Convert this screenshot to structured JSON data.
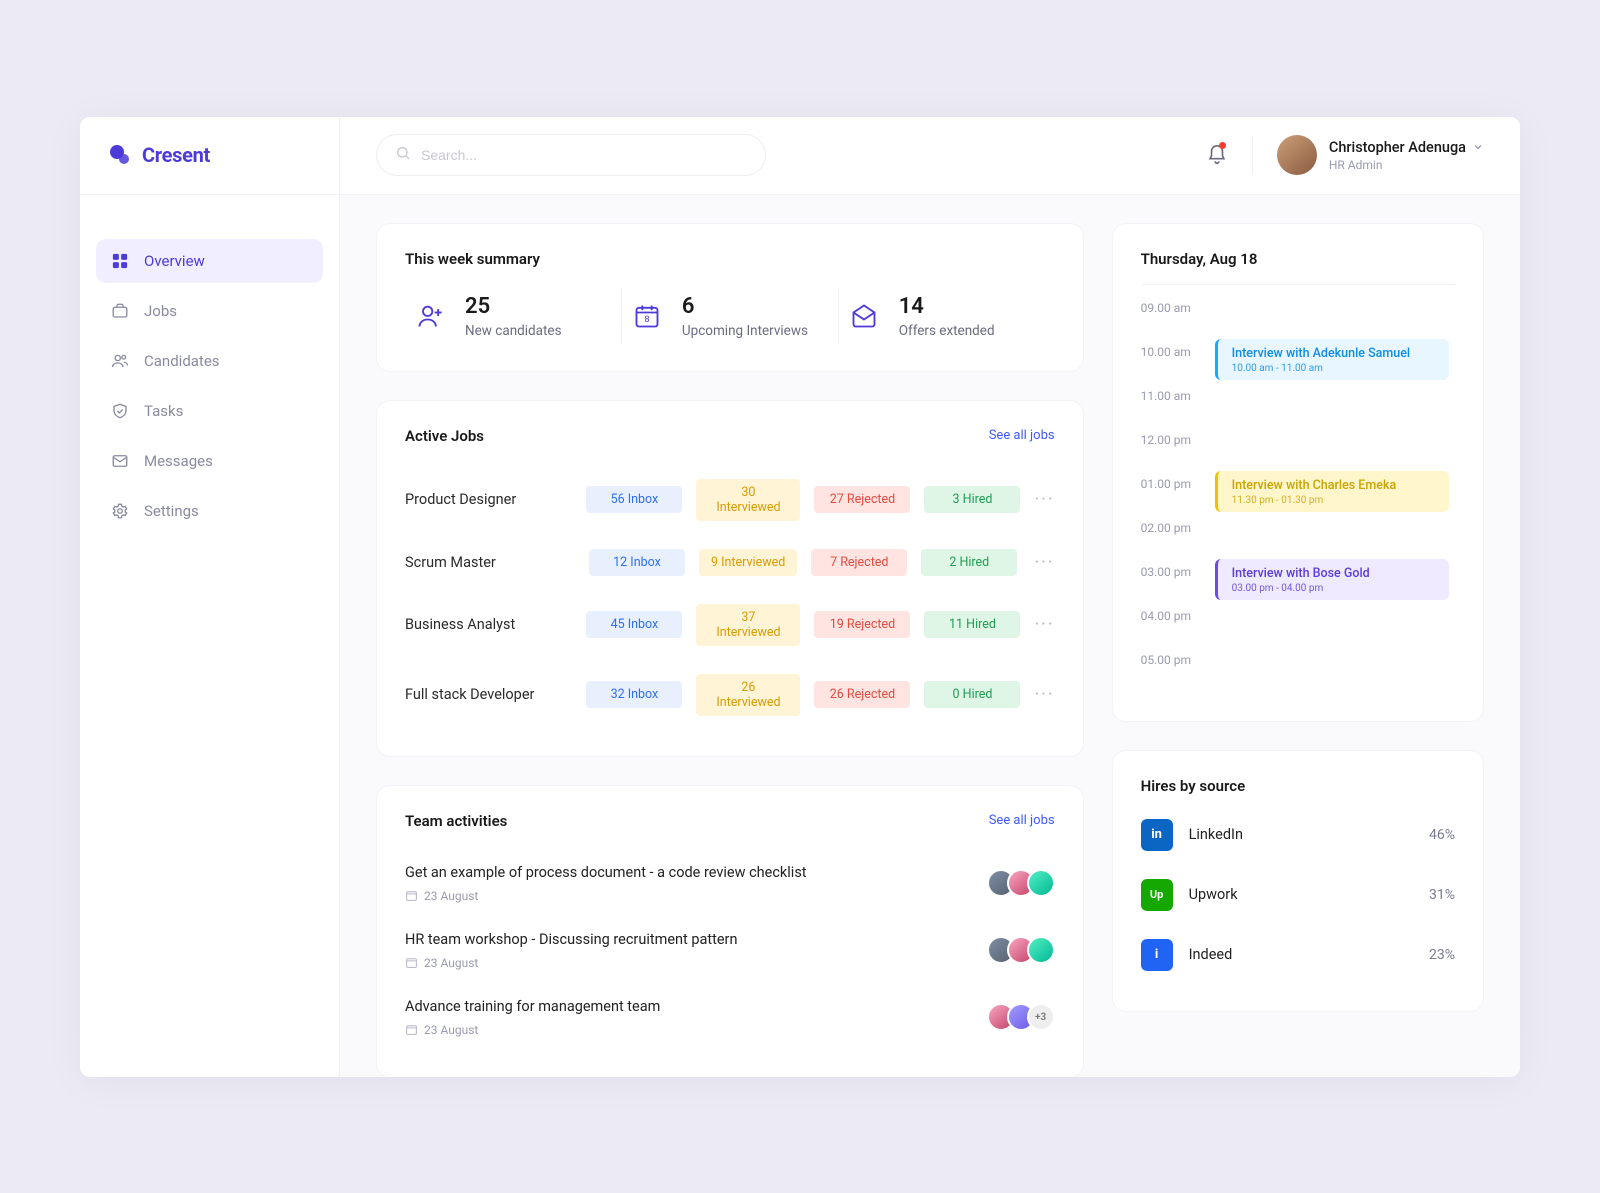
{
  "brand": {
    "name": "Cresent"
  },
  "nav": {
    "items": [
      {
        "label": "Overview",
        "icon": "grid-icon",
        "active": true
      },
      {
        "label": "Jobs",
        "icon": "briefcase-icon",
        "active": false
      },
      {
        "label": "Candidates",
        "icon": "users-icon",
        "active": false
      },
      {
        "label": "Tasks",
        "icon": "shield-check-icon",
        "active": false
      },
      {
        "label": "Messages",
        "icon": "mail-icon",
        "active": false
      },
      {
        "label": "Settings",
        "icon": "gear-icon",
        "active": false
      }
    ]
  },
  "search": {
    "placeholder": "Search..."
  },
  "user": {
    "name": "Christopher Adenuga",
    "role": "HR Admin"
  },
  "summary": {
    "title": "This week summary",
    "stats": [
      {
        "value": "25",
        "label": "New candidates",
        "icon": "user-plus-icon"
      },
      {
        "value": "6",
        "label": "Upcoming Interviews",
        "icon": "calendar-icon"
      },
      {
        "value": "14",
        "label": "Offers extended",
        "icon": "mail-open-icon"
      }
    ]
  },
  "jobs": {
    "title": "Active Jobs",
    "see_all": "See all jobs",
    "rows": [
      {
        "name": "Product Designer",
        "inbox": "56 Inbox",
        "interviewed": "30 Interviewed",
        "rejected": "27 Rejected",
        "hired": "3 Hired"
      },
      {
        "name": "Scrum Master",
        "inbox": "12 Inbox",
        "interviewed": "9 Interviewed",
        "rejected": "7 Rejected",
        "hired": "2 Hired"
      },
      {
        "name": "Business Analyst",
        "inbox": "45 Inbox",
        "interviewed": "37 Interviewed",
        "rejected": "19 Rejected",
        "hired": "11 Hired"
      },
      {
        "name": "Full stack Developer",
        "inbox": "32 Inbox",
        "interviewed": "26 Interviewed",
        "rejected": "26 Rejected",
        "hired": "0 Hired"
      }
    ]
  },
  "activities": {
    "title": "Team activities",
    "see_all": "See all jobs",
    "items": [
      {
        "title": "Get an example of process document - a code review checklist",
        "date": "23 August",
        "extra": ""
      },
      {
        "title": "HR team workshop - Discussing recruitment pattern",
        "date": "23 August",
        "extra": ""
      },
      {
        "title": "Advance training for management team",
        "date": "23 August",
        "extra": "+3"
      }
    ]
  },
  "schedule": {
    "date": "Thursday, Aug 18",
    "slots": [
      "09.00 am",
      "10.00 am",
      "11.00 am",
      "12.00 pm",
      "01.00 pm",
      "02.00 pm",
      "03.00 pm",
      "04.00 pm",
      "05.00 pm"
    ],
    "events": [
      {
        "at": 1,
        "cls": "ev-blue",
        "title": "Interview with Adekunle Samuel",
        "time": "10.00 am - 11.00 am"
      },
      {
        "at": 4,
        "cls": "ev-yellow",
        "title": "Interview with Charles Emeka",
        "time": "11.30 pm - 01.30 pm"
      },
      {
        "at": 6,
        "cls": "ev-purple",
        "title": "Interview with Bose Gold",
        "time": "03.00 pm - 04.00 pm"
      }
    ]
  },
  "hires": {
    "title": "Hires by source",
    "sources": [
      {
        "name": "LinkedIn",
        "pct": "46%",
        "cls": "src-linkedin",
        "glyph": "in"
      },
      {
        "name": "Upwork",
        "pct": "31%",
        "cls": "src-upwork",
        "glyph": "Up"
      },
      {
        "name": "Indeed",
        "pct": "23%",
        "cls": "src-indeed",
        "glyph": "i"
      }
    ]
  }
}
